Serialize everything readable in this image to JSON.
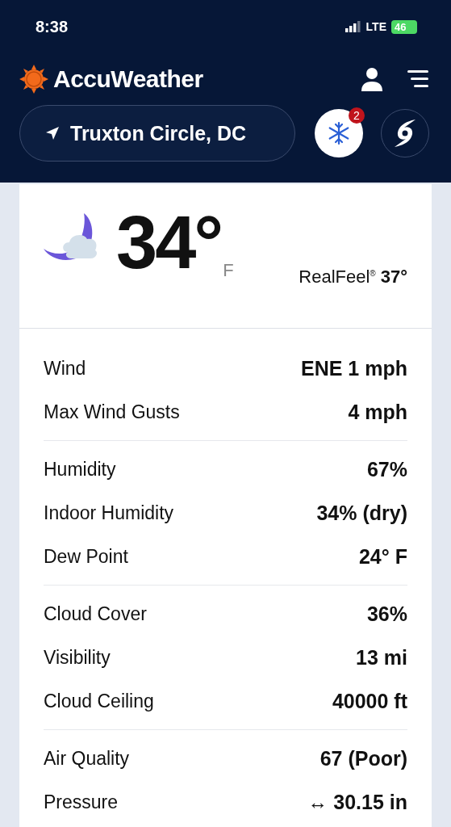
{
  "status_bar": {
    "time": "8:38",
    "network": "LTE",
    "battery": "46"
  },
  "header": {
    "brand": "AccuWeather",
    "location": "Truxton Circle, DC",
    "alerts_badge": "2"
  },
  "current": {
    "temperature": "34°",
    "unit": "F",
    "realfeel_label": "RealFeel$^{®}$",
    "realfeel_value": "37°"
  },
  "details": [
    [
      {
        "label": "Wind",
        "value": "ENE 1 mph"
      },
      {
        "label": "Max Wind Gusts",
        "value": "4 mph"
      }
    ],
    [
      {
        "label": "Humidity",
        "value": "67%"
      },
      {
        "label": "Indoor Humidity",
        "value": "34% (dry)"
      },
      {
        "label": "Dew Point",
        "value": "24° F"
      }
    ],
    [
      {
        "label": "Cloud Cover",
        "value": "36%"
      },
      {
        "label": "Visibility",
        "value": "13 mi"
      },
      {
        "label": "Cloud Ceiling",
        "value": "40000 ft"
      }
    ],
    [
      {
        "label": "Air Quality",
        "value": "67 (Poor)"
      },
      {
        "label": "Pressure",
        "value": "↔ 30.15 in"
      }
    ]
  ]
}
